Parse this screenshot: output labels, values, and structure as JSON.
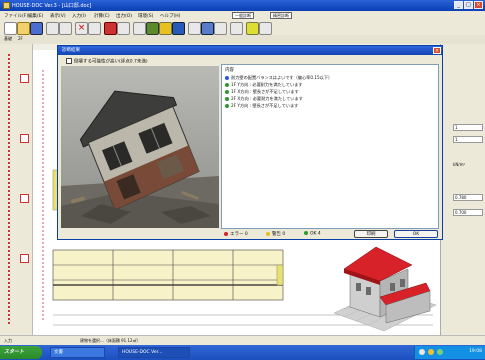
{
  "window": {
    "title": "HOUSE-DOC Ver.3 - [山口邸.doc]",
    "buttons": {
      "minimize": "_",
      "maximize": "□",
      "close": "×"
    }
  },
  "menubar": {
    "items": [
      "ファイル(F)",
      "編集(E)",
      "表示(V)",
      "入力(I)",
      "計算(C)",
      "出力(O)",
      "環境(S)",
      "ヘルプ(H)"
    ],
    "modes": [
      "一般診断",
      "精密診断"
    ]
  },
  "toolbar2": {
    "labels": [
      "基礎",
      "2F"
    ]
  },
  "dialog": {
    "title": "診断結果",
    "close": "×",
    "checkbox_label": "倒壊する可能性が高い(評点0.7未満)",
    "photo_alt": "倒壊家屋の写真",
    "results_header": "内容",
    "results": [
      {
        "status": "blue",
        "text": "耐力壁の配置バランスはよいです（偏心率0.15以下）"
      },
      {
        "status": "green",
        "text": "1F Y方向 : 必要耐力を満たしています"
      },
      {
        "status": "green",
        "text": "1F X方向 : 壁長さが不足しています"
      },
      {
        "status": "green",
        "text": "2F X方向 : 必要耐力を満たしています"
      },
      {
        "status": "green",
        "text": "2F Y方向 : 壁長さが不足しています"
      }
    ],
    "legend": [
      {
        "color": "#d22",
        "label": "エラー 0"
      },
      {
        "color": "#e0c020",
        "label": "警告 0"
      },
      {
        "color": "#2a9a2a",
        "label": "OK 4"
      }
    ],
    "buttons": {
      "print": "印刷",
      "ok": "OK"
    }
  },
  "rightpanel": {
    "fields": [
      {
        "label": "",
        "value": "1"
      },
      {
        "label": "",
        "value": "1"
      },
      {
        "label": "kN/m²",
        "value": ""
      },
      {
        "label": "",
        "value": "0.780"
      },
      {
        "label": "",
        "value": "0.700"
      }
    ]
  },
  "statusbar": {
    "left": "入力",
    "text": "建物を選択...（床面積 91.12㎡）"
  },
  "taskbar": {
    "start": "スタート",
    "items": [
      "文書",
      "HOUSE-DOC Ver..."
    ],
    "clock": "19:08"
  },
  "colors": {
    "titlebar": "#1444b4",
    "roof": "#d8222a",
    "wall_yellow": "#e8e070",
    "taskbar": "#245edb"
  }
}
